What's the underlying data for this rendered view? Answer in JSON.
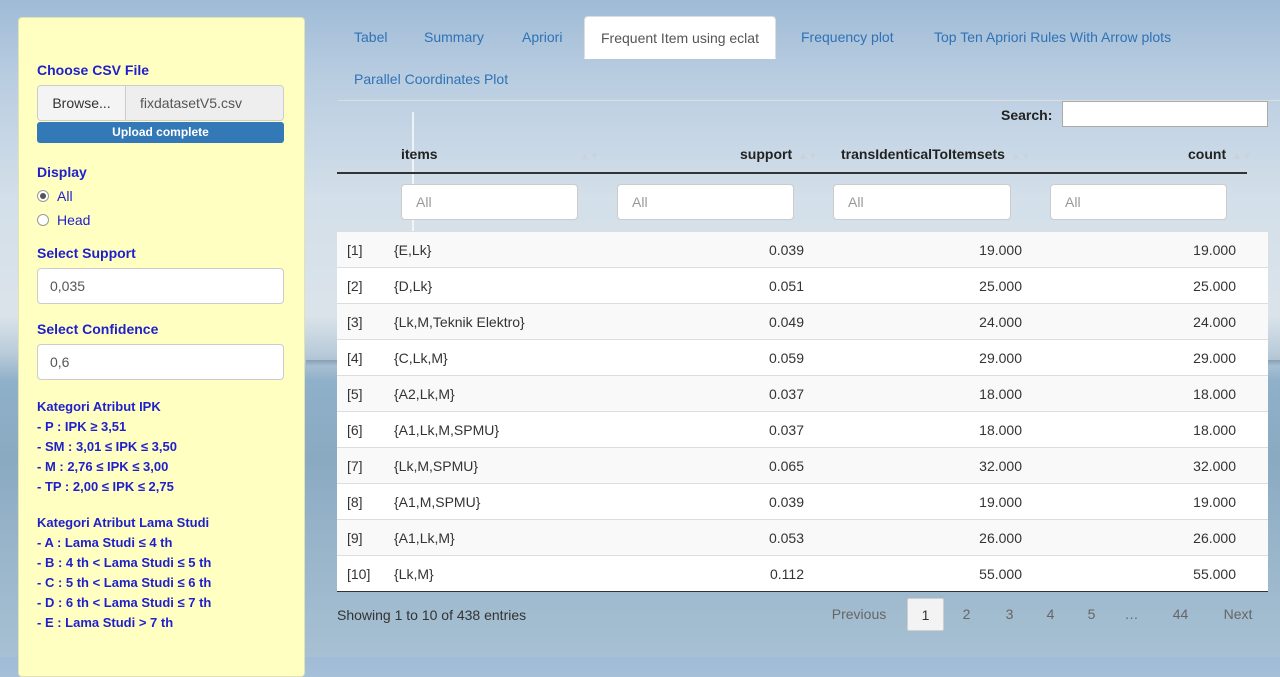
{
  "sidebar": {
    "csv_label": "Choose CSV File",
    "browse_label": "Browse...",
    "file_name": "fixdatasetV5.csv",
    "upload_status": "Upload complete",
    "display_label": "Display",
    "display_options": [
      "All",
      "Head"
    ],
    "display_selected": "All",
    "support_label": "Select Support",
    "support_value": "0,035",
    "confidence_label": "Select Confidence",
    "confidence_value": "0,6",
    "ipk_title": "Kategori Atribut IPK",
    "ipk_items": [
      "- P : IPK ≥ 3,51",
      "- SM : 3,01 ≤ IPK ≤ 3,50",
      "- M : 2,76 ≤ IPK ≤ 3,00",
      "- TP : 2,00 ≤ IPK ≤ 2,75"
    ],
    "study_title": "Kategori Atribut Lama Studi",
    "study_items": [
      "- A : Lama Studi ≤ 4 th",
      "- B : 4 th < Lama Studi ≤ 5 th",
      "- C : 5 th < Lama Studi ≤ 6 th",
      "- D : 6 th < Lama Studi ≤ 7 th",
      "- E : Lama Studi > 7 th"
    ]
  },
  "tabs": [
    {
      "label": "Tabel"
    },
    {
      "label": "Summary"
    },
    {
      "label": "Apriori"
    },
    {
      "label": "Frequent Item using eclat",
      "active": true
    },
    {
      "label": "Frequency plot"
    },
    {
      "label": "Top Ten Apriori Rules With Arrow plots"
    },
    {
      "label": "Parallel Coordinates Plot"
    }
  ],
  "table": {
    "search_label": "Search:",
    "columns": [
      "items",
      "support",
      "transIdenticalToItemsets",
      "count"
    ],
    "filter_placeholder": "All",
    "rows": [
      [
        "[1]",
        "{E,Lk}",
        "0.039",
        "19.000",
        "19.000"
      ],
      [
        "[2]",
        "{D,Lk}",
        "0.051",
        "25.000",
        "25.000"
      ],
      [
        "[3]",
        "{Lk,M,Teknik Elektro}",
        "0.049",
        "24.000",
        "24.000"
      ],
      [
        "[4]",
        "{C,Lk,M}",
        "0.059",
        "29.000",
        "29.000"
      ],
      [
        "[5]",
        "{A2,Lk,M}",
        "0.037",
        "18.000",
        "18.000"
      ],
      [
        "[6]",
        "{A1,Lk,M,SPMU}",
        "0.037",
        "18.000",
        "18.000"
      ],
      [
        "[7]",
        "{Lk,M,SPMU}",
        "0.065",
        "32.000",
        "32.000"
      ],
      [
        "[8]",
        "{A1,M,SPMU}",
        "0.039",
        "19.000",
        "19.000"
      ],
      [
        "[9]",
        "{A1,Lk,M}",
        "0.053",
        "26.000",
        "26.000"
      ],
      [
        "[10]",
        "{Lk,M}",
        "0.112",
        "55.000",
        "55.000"
      ]
    ],
    "info": "Showing 1 to 10 of 438 entries",
    "pagination": {
      "previous": "Previous",
      "pages": [
        "1",
        "2",
        "3",
        "4",
        "5",
        "…",
        "44"
      ],
      "current": "1",
      "next": "Next"
    }
  }
}
